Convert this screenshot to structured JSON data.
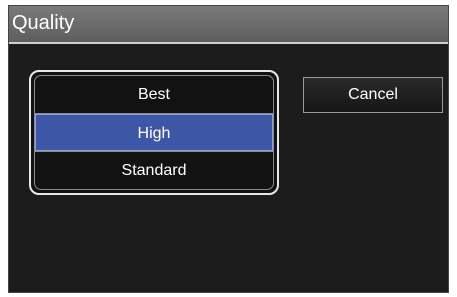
{
  "dialog": {
    "title": "Quality"
  },
  "options": [
    {
      "label": "Best",
      "selected": false
    },
    {
      "label": "High",
      "selected": true
    },
    {
      "label": "Standard",
      "selected": false
    }
  ],
  "cancel_label": "Cancel",
  "colors": {
    "selected_background": "#3e56a6",
    "dialog_background": "#1c1c1c",
    "titlebar_background": "#6b6b6b"
  }
}
